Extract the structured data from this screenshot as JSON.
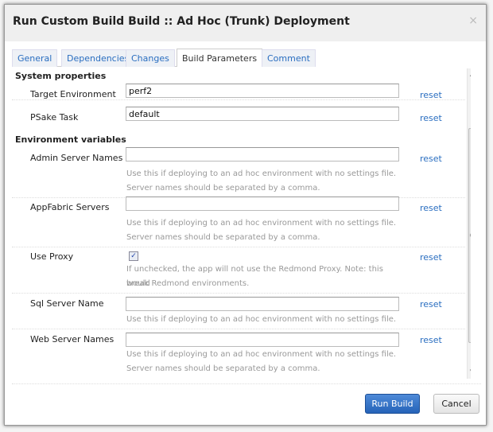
{
  "dialog": {
    "title": "Run Custom Build Build :: Ad Hoc (Trunk) Deployment",
    "close": "×"
  },
  "tabs": [
    {
      "label": "General"
    },
    {
      "label": "Dependencies"
    },
    {
      "label": "Changes"
    },
    {
      "label": "Build Parameters",
      "active": true
    },
    {
      "label": "Comment"
    }
  ],
  "sections": {
    "system": "System properties",
    "env": "Environment variables"
  },
  "fields": {
    "target": {
      "label": "Target Environment",
      "value": "perf2",
      "reset": "reset"
    },
    "psake": {
      "label": "PSake Task",
      "value": "default",
      "reset": "reset"
    },
    "admin": {
      "label": "Admin Server Names",
      "value": "",
      "reset": "reset",
      "help1": "Use this if deploying to an ad hoc environment with no settings file.",
      "help2": "Server names should be separated by a comma."
    },
    "appfabric": {
      "label": "AppFabric Servers",
      "value": "",
      "reset": "reset",
      "help1": "Use this if deploying to an ad hoc environment with no settings file.",
      "help2": "Server names should be separated by a comma."
    },
    "proxy": {
      "label": "Use Proxy",
      "checked": true,
      "check": "✓",
      "reset": "reset",
      "help1": "If unchecked, the app will not use the Redmond Proxy. Note: this would",
      "help2": "break Redmond environments."
    },
    "sql": {
      "label": "Sql Server Name",
      "value": "",
      "reset": "reset",
      "help1": "Use this if deploying to an ad hoc environment with no settings file."
    },
    "web": {
      "label": "Web Server Names",
      "value": "",
      "reset": "reset",
      "help1": "Use this if deploying to an ad hoc environment with no settings file.",
      "help2": "Server names should be separated by a comma."
    }
  },
  "footer": {
    "run": "Run Build",
    "cancel": "Cancel"
  },
  "colors": {
    "accent": "#2a6ec0",
    "primary_button": "#2563b8"
  }
}
